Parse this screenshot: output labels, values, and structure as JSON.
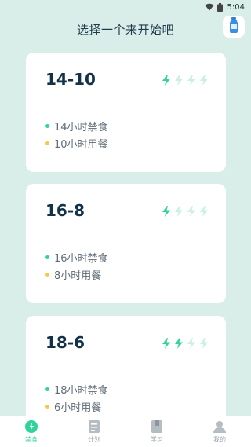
{
  "status_bar": {
    "time": "5:04"
  },
  "header": {
    "title": "选择一个来开始吧"
  },
  "colors": {
    "accent": "#2fd49a",
    "bolt_active": "#2fd49a",
    "bolt_inactive": "#c9f1e3",
    "dot_fast": "#2fd49a",
    "dot_eat": "#f6c94a",
    "background": "#d9eee9"
  },
  "plans": [
    {
      "name": "14-10",
      "level": 1,
      "max_level": 4,
      "fast_text": "14小时禁食",
      "eat_text": "10小时用餐"
    },
    {
      "name": "16-8",
      "level": 1,
      "max_level": 4,
      "fast_text": "16小时禁食",
      "eat_text": "8小时用餐"
    },
    {
      "name": "18-6",
      "level": 2,
      "max_level": 4,
      "fast_text": "18小时禁食",
      "eat_text": "6小时用餐"
    }
  ],
  "bottom_nav": [
    {
      "label": "禁食",
      "icon": "bolt-icon",
      "active": true
    },
    {
      "label": "计划",
      "icon": "plan-icon",
      "active": false
    },
    {
      "label": "学习",
      "icon": "book-icon",
      "active": false
    },
    {
      "label": "我的",
      "icon": "profile-icon",
      "active": false
    }
  ]
}
